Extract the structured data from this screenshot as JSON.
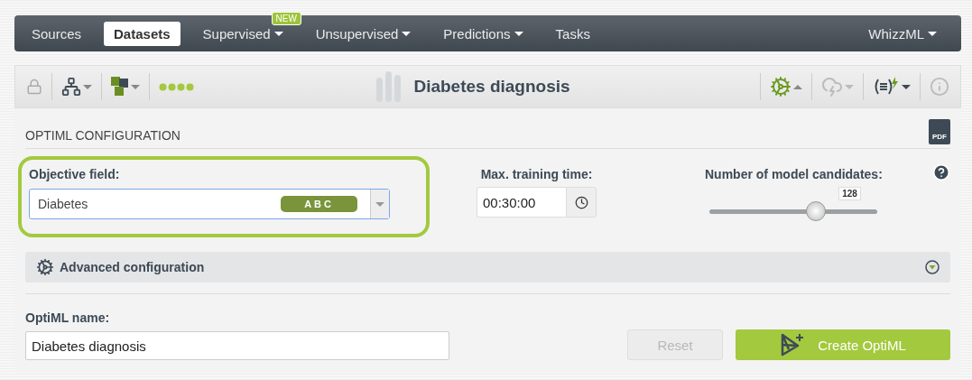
{
  "nav": {
    "items": [
      {
        "label": "Sources",
        "selected": false,
        "dropdown": false
      },
      {
        "label": "Datasets",
        "selected": true,
        "dropdown": false
      },
      {
        "label": "Supervised",
        "selected": false,
        "dropdown": true,
        "badge": "NEW"
      },
      {
        "label": "Unsupervised",
        "selected": false,
        "dropdown": true
      },
      {
        "label": "Predictions",
        "selected": false,
        "dropdown": true
      },
      {
        "label": "Tasks",
        "selected": false,
        "dropdown": false
      }
    ],
    "right": {
      "label": "WhizzML",
      "dropdown": true
    }
  },
  "toolbar": {
    "title": "Diabetes diagnosis"
  },
  "config": {
    "heading": "OPTIML CONFIGURATION",
    "pdf_label": "PDF",
    "objective": {
      "label": "Objective field:",
      "value": "Diabetes",
      "type_badge": "ABC"
    },
    "max_time": {
      "label": "Max. training time:",
      "value": "00:30:00"
    },
    "candidates": {
      "label": "Number of model candidates:",
      "reading": "128",
      "level": 0.63
    },
    "advanced": {
      "label": "Advanced configuration",
      "expanded": false
    },
    "name": {
      "label": "OptiML name:",
      "value": "Diabetes diagnosis"
    },
    "reset": {
      "label": "Reset",
      "disabled": true
    },
    "create": {
      "label": "Create OptiML",
      "disabled": false
    }
  }
}
